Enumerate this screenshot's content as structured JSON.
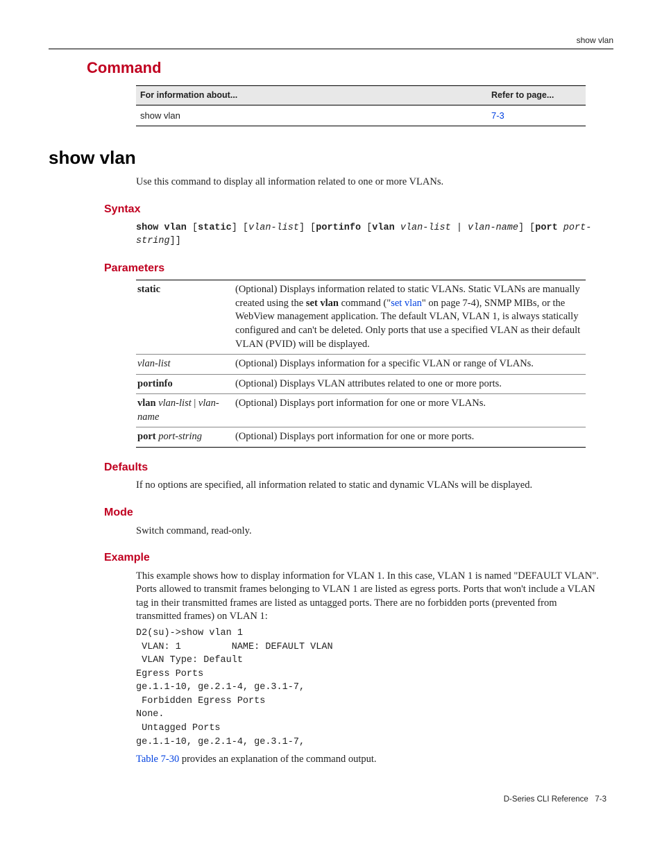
{
  "header": {
    "right": "show vlan"
  },
  "section_title": "Command",
  "info_table": {
    "h1": "For information about...",
    "h2": "Refer to page...",
    "r1": "show vlan",
    "r2": "7-3"
  },
  "command_title": "show vlan",
  "intro": "Use this command to display all information related to one or more VLANs.",
  "syntax_title": "Syntax",
  "syntax": {
    "p1": "show vlan",
    "p2": " [",
    "p3": "static",
    "p4": "] [",
    "p5": "vlan-list",
    "p6": "] [",
    "p7": "portinfo",
    "p8": " [",
    "p9": "vlan",
    "p10": " ",
    "p11": "vlan-list",
    "p12": " | ",
    "p13": "vlan-name",
    "p14": "] [",
    "p15": "port",
    "p16": " ",
    "p17": "port-string",
    "p18": "]]"
  },
  "parameters_title": "Parameters",
  "params": {
    "r1": {
      "name": "static",
      "d1": "(Optional) Displays information related to static VLANs. Static VLANs are manually created using the ",
      "d2": "set vlan",
      "d3": " command (\"",
      "d4": "set vlan",
      "d5": "\" on page 7-4), SNMP MIBs, or the WebView management application. The default VLAN, VLAN 1, is always statically configured and can't be deleted. Only ports that use a specified VLAN as their default VLAN (PVID) will be displayed."
    },
    "r2": {
      "name": "vlan-list",
      "desc": "(Optional) Displays information for a specific VLAN or range of VLANs."
    },
    "r3": {
      "name": "portinfo",
      "desc": "(Optional) Displays VLAN attributes related to one or more ports."
    },
    "r4": {
      "n1": "vlan",
      "n2": " vlan-list ",
      "n3": "|",
      "n4": " vlan-name",
      "desc": "(Optional) Displays port information for one or more VLANs."
    },
    "r5": {
      "n1": "port",
      "n2": " port-string",
      "desc": "(Optional) Displays port information for one or more ports."
    }
  },
  "defaults_title": "Defaults",
  "defaults_text": "If no options are specified, all information related to static and dynamic VLANs will be displayed.",
  "mode_title": "Mode",
  "mode_text": "Switch command, read-only.",
  "example_title": "Example",
  "example_intro": "This example shows how to display information for VLAN 1. In this case, VLAN 1 is named \"DEFAULT VLAN\". Ports allowed to transmit frames belonging to VLAN 1 are listed as egress ports. Ports that won't include a VLAN tag in their transmitted frames are listed as untagged ports. There are no forbidden ports (prevented from transmitted frames) on VLAN 1:",
  "example_code": "D2(su)->show vlan 1\n VLAN: 1         NAME: DEFAULT VLAN\n VLAN Type: Default\nEgress Ports\nge.1.1-10, ge.2.1-4, ge.3.1-7,\n Forbidden Egress Ports\nNone.\n Untagged Ports\nge.1.1-10, ge.2.1-4, ge.3.1-7,",
  "example_followup": {
    "link": "Table 7-30",
    "rest": " provides an explanation of the command output."
  },
  "footer": {
    "left": "D-Series CLI Reference",
    "right": "7-3"
  }
}
